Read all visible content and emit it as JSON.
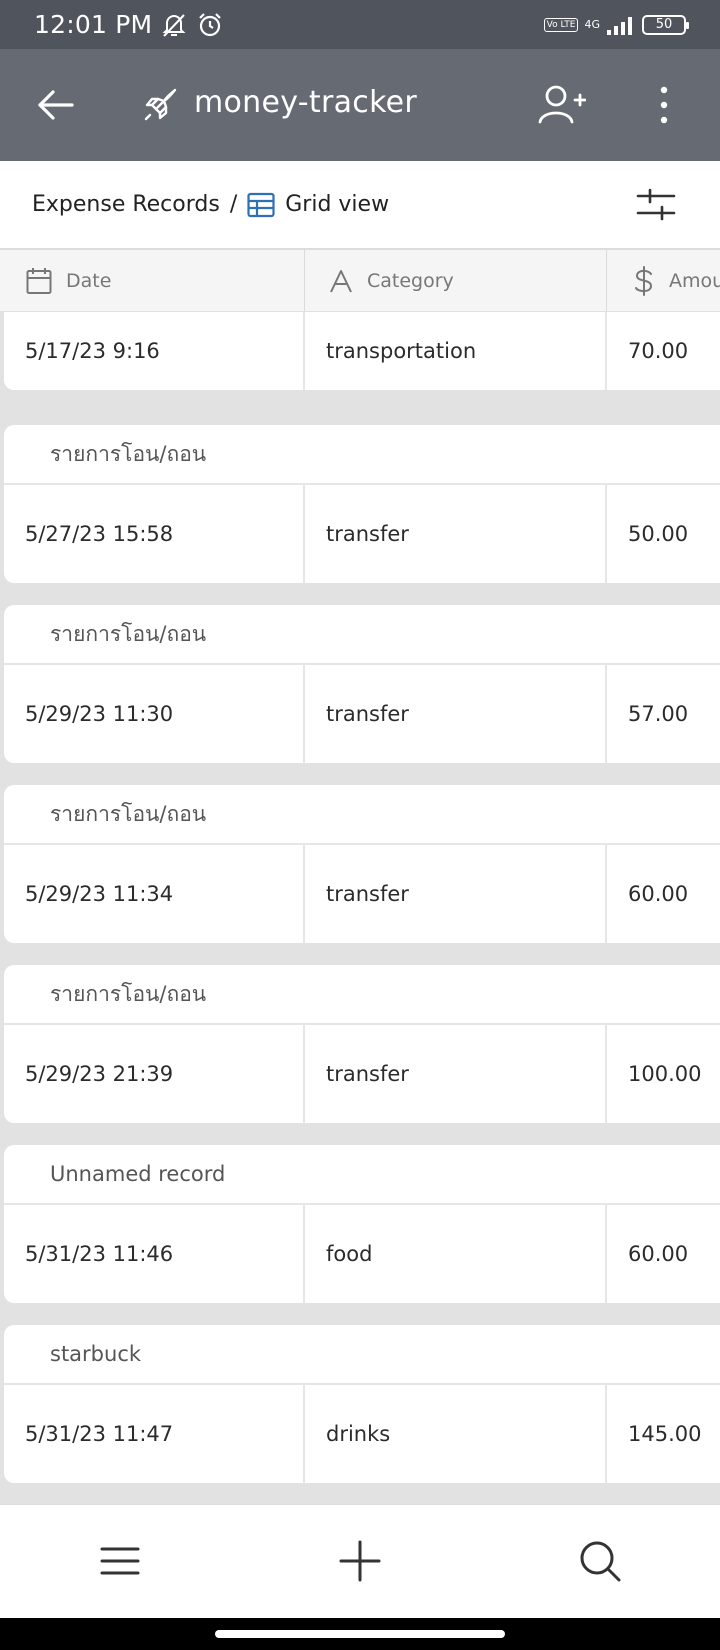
{
  "status_bar": {
    "time": "12:01 PM",
    "network_label": "4G",
    "volte_label": "Vo LTE",
    "battery": "50"
  },
  "app_bar": {
    "title": "money-tracker"
  },
  "breadcrumb": {
    "table": "Expense Records",
    "separator": "/",
    "view": "Grid view"
  },
  "columns": {
    "date": "Date",
    "category": "Category",
    "amount": "Amou"
  },
  "records": [
    {
      "name": "",
      "date": "5/17/23 9:16",
      "category": "transportation",
      "amount": "70.00"
    },
    {
      "name": "รายการโอน/ถอน",
      "date": "5/27/23 15:58",
      "category": "transfer",
      "amount": "50.00"
    },
    {
      "name": "รายการโอน/ถอน",
      "date": "5/29/23 11:30",
      "category": "transfer",
      "amount": "57.00"
    },
    {
      "name": "รายการโอน/ถอน",
      "date": "5/29/23 11:34",
      "category": "transfer",
      "amount": "60.00"
    },
    {
      "name": "รายการโอน/ถอน",
      "date": "5/29/23 21:39",
      "category": "transfer",
      "amount": "100.00"
    },
    {
      "name": "Unnamed record",
      "date": "5/31/23 11:46",
      "category": "food",
      "amount": "60.00"
    },
    {
      "name": "starbuck",
      "date": "5/31/23 11:47",
      "category": "drinks",
      "amount": "145.00"
    }
  ],
  "colors": {
    "status_bar_bg": "#4f545d",
    "app_bar_bg": "#656a73",
    "grid_icon_accent": "#2f6fb5",
    "list_bg": "#e2e2e2"
  },
  "icons": {
    "back": "arrow-left-icon",
    "app": "rocket-icon",
    "add_user": "add-user-icon",
    "more": "more-vertical-icon",
    "view": "grid-view-icon",
    "filter": "filter-sliders-icon",
    "date_column": "calendar-icon",
    "category_column": "text-field-icon",
    "amount_column": "dollar-icon",
    "menu": "menu-icon",
    "add": "plus-icon",
    "search": "search-icon"
  }
}
